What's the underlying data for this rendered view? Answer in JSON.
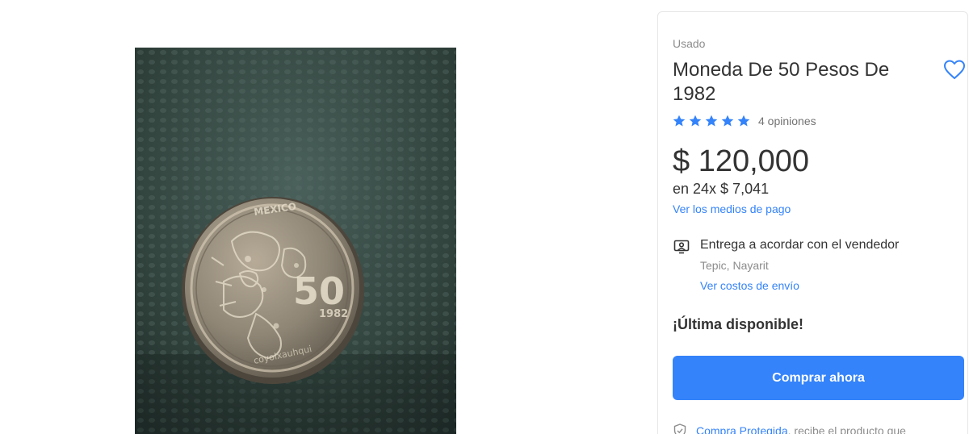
{
  "gallery": {
    "image_alt": "Moneda De 50 Pesos De 1982",
    "coin_text": {
      "country": "MEXICO",
      "denomination": "50",
      "year": "1982",
      "legend": "coyolxauhqui"
    }
  },
  "product": {
    "condition": "Usado",
    "title": "Moneda De 50 Pesos De 1982",
    "rating": 5,
    "reviews_label": "4 opiniones",
    "price": "$ 120,000",
    "installments": "en 24x $ 7,041",
    "payment_link": "Ver los medios de pago"
  },
  "delivery": {
    "icon": "person-card-icon",
    "title": "Entrega a acordar con el vendedor",
    "location": "Tepic, Nayarit",
    "shipping_link": "Ver costos de envío"
  },
  "stock_label": "¡Última disponible!",
  "buy_button_label": "Comprar ahora",
  "protection": {
    "icon": "shield-check-icon",
    "link": "Compra Protegida",
    "text": ", recibe el producto que"
  },
  "colors": {
    "accent": "#3483fa",
    "text": "#333333",
    "muted": "#8c8c8c"
  }
}
